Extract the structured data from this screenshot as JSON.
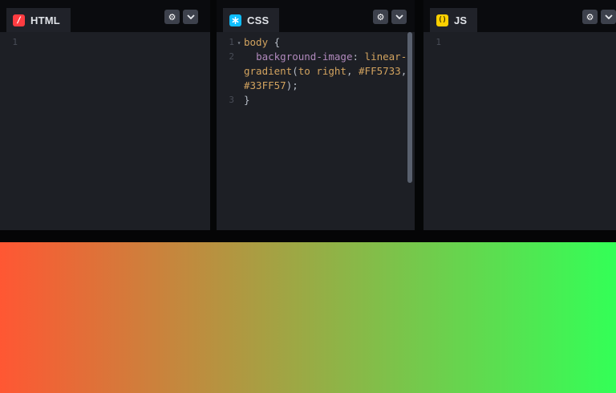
{
  "colors": {
    "html_accent": "#FF3C41",
    "css_accent": "#0EBEFF",
    "js_accent": "#FCD000",
    "editor_bg": "#1d1f25",
    "gold_token": "#d2a35f",
    "property_token": "#b189bd"
  },
  "panels": [
    {
      "label": "HTML",
      "glyph": "/",
      "first_line_number": "1"
    },
    {
      "label": "CSS",
      "glyph": "*",
      "first_line_number": "1"
    },
    {
      "label": "JS",
      "glyph": "()",
      "first_line_number": "1"
    }
  ],
  "header_buttons": {
    "settings_glyph": "⚙"
  },
  "css_code": {
    "rows": [
      {
        "num": "1",
        "fold": "▾",
        "tokens": [
          {
            "t": "body",
            "c": "tk-gold"
          },
          {
            "t": " {",
            "c": "tk-pun"
          }
        ]
      },
      {
        "num": "2",
        "fold": "",
        "tokens": [
          {
            "t": "  ",
            "c": "tk-pun"
          },
          {
            "t": "background-image",
            "c": "tk-prop"
          },
          {
            "t": ": ",
            "c": "tk-pun"
          },
          {
            "t": "linear-",
            "c": "tk-gold"
          }
        ]
      },
      {
        "num": "",
        "fold": "",
        "tokens": [
          {
            "t": "gradient",
            "c": "tk-gold"
          },
          {
            "t": "(",
            "c": "tk-pun"
          },
          {
            "t": "to right",
            "c": "tk-gold"
          },
          {
            "t": ", ",
            "c": "tk-pun"
          },
          {
            "t": "#FF5733",
            "c": "tk-gold"
          },
          {
            "t": ",",
            "c": "tk-pun"
          }
        ]
      },
      {
        "num": "",
        "fold": "",
        "tokens": [
          {
            "t": "#33FF57",
            "c": "tk-gold"
          },
          {
            "t": ");",
            "c": "tk-pun"
          }
        ]
      },
      {
        "num": "3",
        "fold": "",
        "tokens": [
          {
            "t": "}",
            "c": "tk-pun"
          }
        ]
      }
    ]
  },
  "preview": {
    "direction": "to right",
    "from": "#FF5733",
    "to": "#33FF57"
  }
}
